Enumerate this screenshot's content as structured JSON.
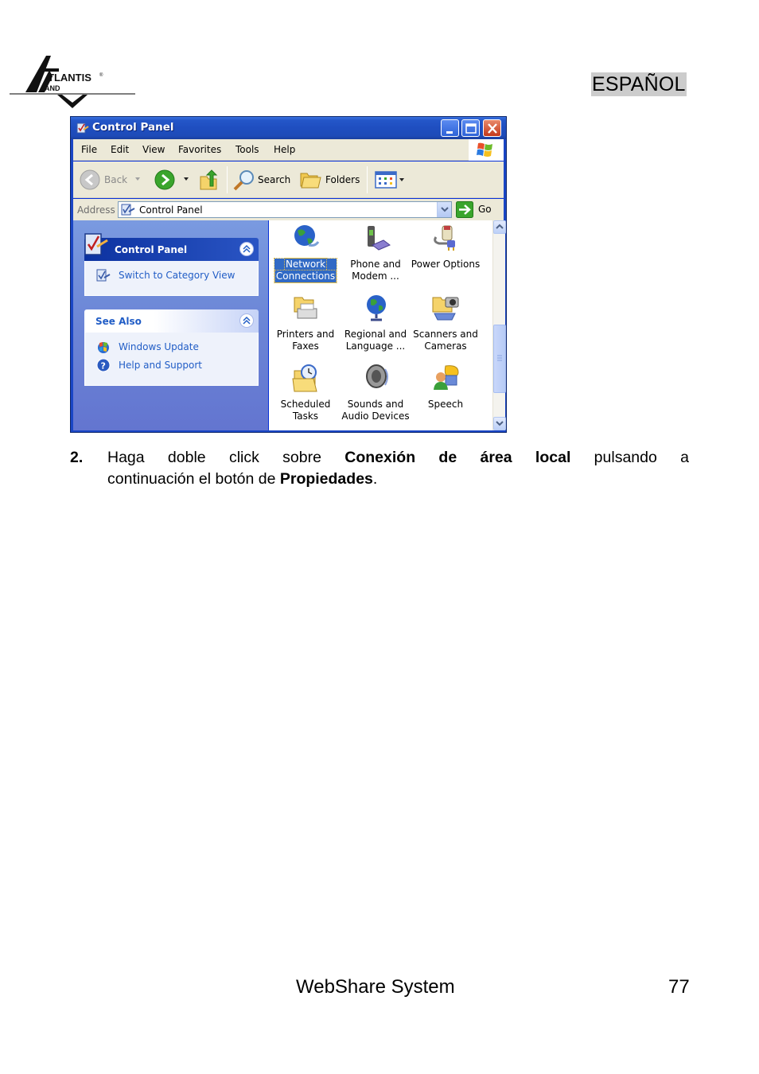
{
  "header": {
    "logo": {
      "brand": "ATLANTIS",
      "sub": "AND",
      "registered": "®"
    },
    "language": "ESPAÑOL"
  },
  "window": {
    "title": "Control Panel",
    "icon": "control-panel-icon",
    "buttons": {
      "minimize": "minimize-icon",
      "maximize": "maximize-icon",
      "close": "close-icon"
    },
    "menu": [
      "File",
      "Edit",
      "View",
      "Favorites",
      "Tools",
      "Help"
    ],
    "toolbar": {
      "back": "Back",
      "search": "Search",
      "folders": "Folders"
    },
    "address": {
      "label": "Address",
      "value": "Control Panel",
      "go": "Go"
    },
    "taskpane": {
      "panels": [
        {
          "title": "Control Panel",
          "links": [
            {
              "label": "Switch to Category View",
              "icon": "category-view-icon"
            }
          ]
        },
        {
          "title": "See Also",
          "links": [
            {
              "label": "Windows Update",
              "icon": "windows-update-icon"
            },
            {
              "label": "Help and Support",
              "icon": "help-icon"
            }
          ]
        }
      ]
    },
    "items": [
      {
        "line1": "Network",
        "line2": "Connections",
        "icon": "network-connections-icon",
        "selected": true
      },
      {
        "line1": "Phone and",
        "line2": "Modem ...",
        "icon": "phone-modem-icon"
      },
      {
        "line1": "Power Options",
        "line2": "",
        "icon": "power-options-icon"
      },
      {
        "line1": "Printers and",
        "line2": "Faxes",
        "icon": "printers-faxes-icon"
      },
      {
        "line1": "Regional and",
        "line2": "Language ...",
        "icon": "regional-language-icon"
      },
      {
        "line1": "Scanners and",
        "line2": "Cameras",
        "icon": "scanners-cameras-icon"
      },
      {
        "line1": "Scheduled",
        "line2": "Tasks",
        "icon": "scheduled-tasks-icon"
      },
      {
        "line1": "Sounds and",
        "line2": "Audio Devices",
        "icon": "sounds-audio-icon"
      },
      {
        "line1": "Speech",
        "line2": "",
        "icon": "speech-icon"
      }
    ],
    "colors": {
      "titlebar": "#2456c8",
      "selection": "#316ac5",
      "link": "#215dc6",
      "chrome": "#ece9d8"
    }
  },
  "step": {
    "number": "2.",
    "parts": {
      "a": "Haga doble click sobre ",
      "b": "Conexión de área local",
      "c": " pulsando a",
      "d": "continuación el botón de ",
      "e": "Propiedades",
      "f": "."
    }
  },
  "footer": {
    "title": "WebShare System",
    "page": "77"
  }
}
